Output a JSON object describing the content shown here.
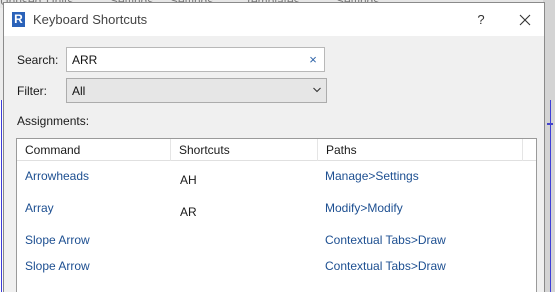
{
  "background": {
    "tabs": [
      "Unused",
      "Units",
      "Settings",
      "Settings",
      "Templates",
      "Settings"
    ]
  },
  "dialog": {
    "title": "Keyboard Shortcuts",
    "app_icon": "R",
    "help_label": "?",
    "close_icon": "close-icon"
  },
  "search": {
    "label": "Search:",
    "value": "ARR",
    "clear_glyph": "×"
  },
  "filter": {
    "label": "Filter:",
    "value": "All"
  },
  "assignments": {
    "label": "Assignments:",
    "columns": [
      "Command",
      "Shortcuts",
      "Paths"
    ],
    "rows": [
      {
        "command": "Arrowheads",
        "shortcut": "AH",
        "path": "Manage>Settings"
      },
      {
        "command": "Array",
        "shortcut": "AR",
        "path": "Modify>Modify"
      },
      {
        "command": "Slope Arrow",
        "shortcut": "",
        "path": "Contextual Tabs>Draw"
      },
      {
        "command": "Slope Arrow",
        "shortcut": "",
        "path": "Contextual Tabs>Draw"
      }
    ]
  },
  "colors": {
    "link_text": "#1d4f91",
    "app_icon_bg": "#2a62b9",
    "dialog_bg": "#f0f0f0"
  }
}
